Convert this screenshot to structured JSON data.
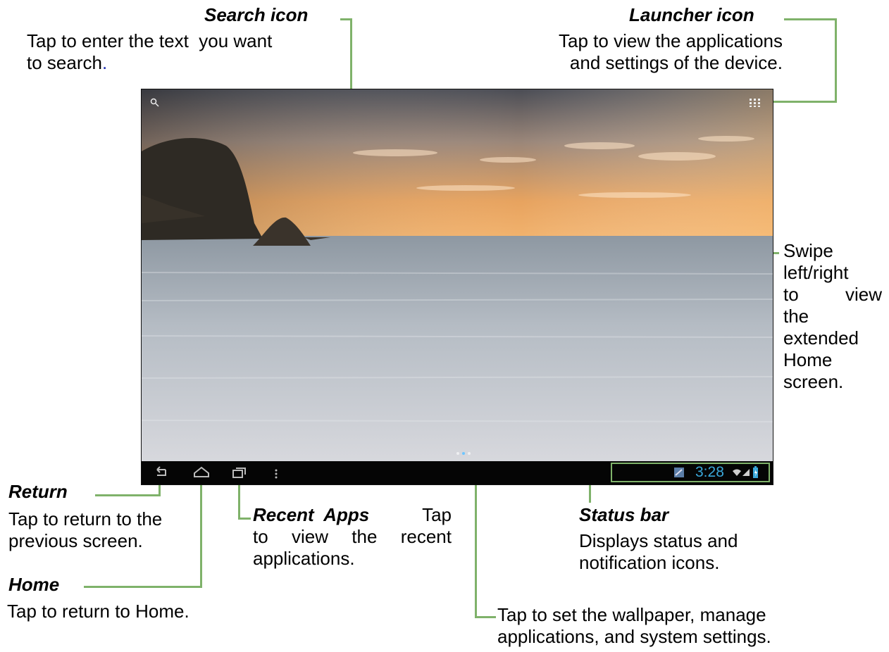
{
  "annotations": {
    "search": {
      "title": "Search icon",
      "desc1": "Tap to enter the text  you want",
      "desc2": "to search",
      "desc2_end": "."
    },
    "launcher": {
      "title": "Launcher icon",
      "desc1": "Tap to view the applications",
      "desc2": "and settings of the device."
    },
    "swipe": {
      "lines": [
        "Swipe",
        "left/right",
        "to",
        "view",
        "the",
        "extended",
        "Home",
        "screen."
      ]
    },
    "return": {
      "title": "Return",
      "desc1": "Tap to return to the",
      "desc2": "previous screen."
    },
    "home": {
      "title": "Home",
      "desc": "Tap to return to Home."
    },
    "recent": {
      "title": "Recent  Apps",
      "desc1": "Tap",
      "desc2": "to view the recent",
      "desc3": "applications."
    },
    "status": {
      "title": "Status bar",
      "desc1": "Displays status and",
      "desc2": "notification icons."
    },
    "menu": {
      "desc1": "Tap to set the wallpaper, manage",
      "desc2": "applications, and system settings."
    }
  },
  "device": {
    "clock": "3:28",
    "icons": [
      "search-icon",
      "launcher-icon",
      "back-icon",
      "home-icon",
      "recent-apps-icon",
      "menu-icon",
      "notification-icon",
      "wifi-icon",
      "signal-icon",
      "battery-icon"
    ]
  },
  "colors": {
    "callout_line": "#7fb26a",
    "clock": "#3aa7d9",
    "navbar": "#050505"
  }
}
